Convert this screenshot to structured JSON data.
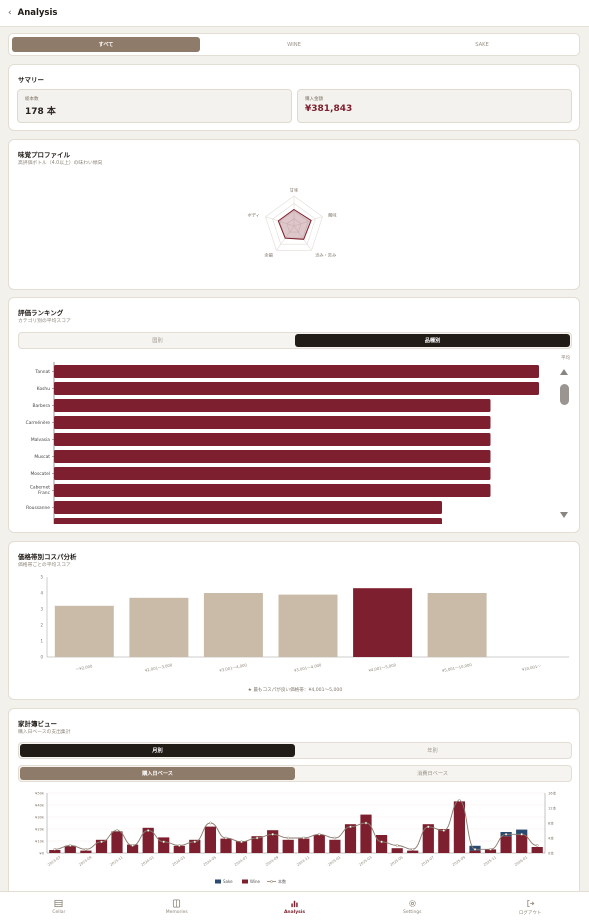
{
  "header": {
    "title": "Analysis"
  },
  "filter_tabs": [
    {
      "label": "すべて",
      "active": true
    },
    {
      "label": "WINE",
      "active": false
    },
    {
      "label": "SAKE",
      "active": false
    }
  ],
  "summary": {
    "title": "サマリー",
    "total_count_label": "総本数",
    "total_count_value": "178 本",
    "total_amount_label": "購入金額",
    "total_amount_value": "¥381,843"
  },
  "taste_profile": {
    "title": "味覚プロファイル",
    "subtitle": "高評価ボトル（4.0以上）の味わい傾向",
    "axes": [
      "甘味",
      "酸味",
      "渋み・苦み",
      "余韻",
      "ボディ"
    ],
    "values": [
      0.55,
      0.6,
      0.55,
      0.5,
      0.55
    ]
  },
  "ranking": {
    "title": "評価ランキング",
    "subtitle": "カテゴリ別の平均スコア",
    "tabs": [
      {
        "label": "国別",
        "active": false
      },
      {
        "label": "品種別",
        "active": true
      }
    ],
    "sort_label": "平均",
    "max_score": 5,
    "items": [
      {
        "name": "Tannat",
        "score": 5.0
      },
      {
        "name": "Koshu",
        "score": 5.0
      },
      {
        "name": "Barbera",
        "score": 4.5
      },
      {
        "name": "Carménère",
        "score": 4.5
      },
      {
        "name": "Malvasia",
        "score": 4.5
      },
      {
        "name": "Muscat",
        "score": 4.5
      },
      {
        "name": "Moscatel",
        "score": 4.5
      },
      {
        "name": "Cabernet Franc",
        "score": 4.5
      },
      {
        "name": "Roussanne",
        "score": 4.0
      },
      {
        "name": "",
        "score": 4.0
      }
    ]
  },
  "price_band": {
    "title": "価格帯別コスパ分析",
    "subtitle": "価格帯ごとの平均スコア",
    "footnote": "★ 最もコスパが良い価格帯：¥4,001〜5,000",
    "colors": {
      "normal": "#c9bba8",
      "highlight": "#7d1f2e"
    },
    "chart_data": {
      "type": "bar",
      "categories": [
        "〜¥2,000",
        "¥2,001〜3,000",
        "¥3,001〜4,000",
        "¥3,001〜4,000",
        "¥4,001〜5,000",
        "¥5,001〜10,000",
        "¥10,001〜"
      ],
      "values": [
        3.2,
        3.7,
        4.0,
        3.9,
        4.3,
        4.0,
        0
      ],
      "highlight_index": 4,
      "ylim": [
        0,
        5
      ],
      "yticks": [
        "0",
        "1",
        "2",
        "3",
        "4",
        "5"
      ]
    }
  },
  "household": {
    "title": "家計簿ビュー",
    "subtitle": "購入日ベースの支出集計",
    "period_tabs": [
      {
        "label": "月別",
        "active": true
      },
      {
        "label": "年別",
        "active": false
      }
    ],
    "basis_tabs": [
      {
        "label": "購入日ベース",
        "active": true
      },
      {
        "label": "消費日ベース",
        "active": false
      }
    ],
    "colors": {
      "sake": "#2a4a70",
      "wine": "#7d1f2e",
      "line": "#8a7b6c"
    },
    "chart_data": {
      "type": "bar",
      "x": [
        "2023-07",
        "2023-08",
        "2023-09",
        "2023-10",
        "2023-11",
        "2023-12",
        "2024-01",
        "2024-02",
        "2024-03",
        "2024-04",
        "2024-05",
        "2024-06",
        "2024-07",
        "2024-08",
        "2024-09",
        "2024-10",
        "2024-11",
        "2024-12",
        "2025-01",
        "2025-02",
        "2025-03",
        "2025-04",
        "2025-05",
        "2025-06",
        "2025-07",
        "2025-08",
        "2025-09",
        "2025-10",
        "2025-11",
        "2025-12",
        "2026-01",
        "2026-02"
      ],
      "xticks": [
        "2023-07",
        "2023-09",
        "2023-11",
        "2024-01",
        "2024-03",
        "2024-05",
        "2024-07",
        "2024-09",
        "2024-11",
        "2025-01",
        "2025-03",
        "2025-05",
        "2025-07",
        "2025-09",
        "2025-11",
        "2026-01"
      ],
      "series": [
        {
          "name": "Sake",
          "values": [
            0,
            0,
            0,
            0,
            0,
            0,
            0,
            0,
            0,
            0,
            0,
            0,
            0,
            0,
            0,
            0,
            0,
            0,
            0,
            0,
            0,
            0,
            0,
            0,
            0,
            0,
            0,
            4000,
            0,
            3500,
            4500,
            0
          ]
        },
        {
          "name": "Wine",
          "values": [
            2500,
            6000,
            2000,
            11000,
            18000,
            7000,
            21000,
            13000,
            6000,
            11000,
            22000,
            12000,
            10000,
            14000,
            19000,
            11000,
            12000,
            15000,
            11000,
            24000,
            32000,
            15000,
            4000,
            2000,
            24000,
            20000,
            43000,
            2000,
            3000,
            14000,
            15000,
            5000
          ]
        },
        {
          "name": "本数",
          "values": [
            1,
            2,
            1,
            3,
            6,
            2,
            6,
            3,
            2,
            3,
            8,
            4,
            3,
            4,
            5,
            4,
            4,
            5,
            4,
            7,
            8,
            3,
            2,
            1,
            7,
            6,
            14,
            1,
            1,
            5,
            5,
            2
          ]
        }
      ],
      "y_left_ticks": [
        "¥0",
        "¥10k",
        "¥20k",
        "¥30k",
        "¥40k",
        "¥50k"
      ],
      "y_right_ticks": [
        "0本",
        "4本",
        "8本",
        "12本",
        "16本"
      ],
      "ylim_left": [
        0,
        50000
      ],
      "ylim_right": [
        0,
        16
      ]
    }
  },
  "nav": [
    {
      "label": "Cellar",
      "icon": "cellar-icon",
      "active": false
    },
    {
      "label": "Memories",
      "icon": "book-icon",
      "active": false
    },
    {
      "label": "Analysis",
      "icon": "chart-icon",
      "active": true
    },
    {
      "label": "Settings",
      "icon": "gear-icon",
      "active": false
    },
    {
      "label": "ログアウト",
      "icon": "logout-icon",
      "active": false
    }
  ]
}
